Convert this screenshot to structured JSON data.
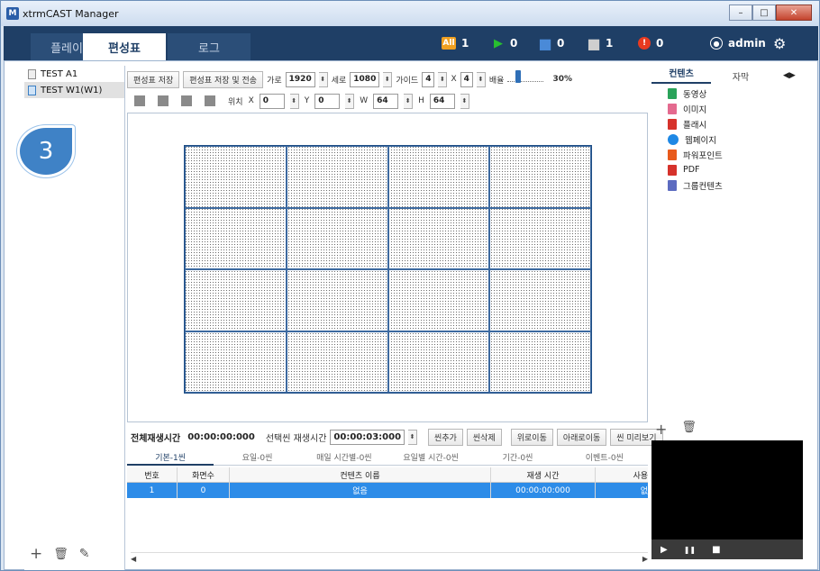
{
  "app": {
    "logo": "M",
    "title": "xtrmCAST Manager",
    "window_buttons": [
      "–",
      "□",
      "✕"
    ]
  },
  "nav": {
    "tabs": [
      "플레이어",
      "편성표",
      "로그"
    ],
    "stats": [
      {
        "icon": "All",
        "label": "1",
        "color": "#f0a020"
      },
      {
        "icon": "▶",
        "label": "0",
        "color": "#28c030"
      },
      {
        "icon": "■",
        "label": "0",
        "color": "#4a8ad8"
      },
      {
        "icon": "■",
        "label": "1",
        "color": "#cfcfcf"
      },
      {
        "icon": "!",
        "label": "0",
        "color": "#e83a20"
      }
    ],
    "user": "admin",
    "settings_icon": "⚙"
  },
  "left": {
    "items": [
      "TEST A1",
      "TEST W1(W1)"
    ],
    "footer": [
      "+",
      "🗑",
      "✎"
    ],
    "badge": "3"
  },
  "toolbar": {
    "save": "편성표 저장",
    "save_send": "편성표 저장 및 전송",
    "w_label": "가로",
    "w": "1920",
    "h_label": "세로",
    "h": "1080",
    "guide_label": "가이드",
    "guide_x": "4",
    "x_sep": "X",
    "guide_y": "4",
    "zoom_label": "배율",
    "zoom": "30%"
  },
  "pos": {
    "label": "위치",
    "x_label": "X",
    "x": "0",
    "y_label": "Y",
    "y": "0",
    "w_label": "W",
    "w": "64",
    "h_label": "H",
    "h": "64"
  },
  "play": {
    "total_label": "전체재생시간",
    "total": "00:00:00:000",
    "sel_label": "선택씬 재생시간",
    "sel": "00:00:03:000",
    "btns": [
      "씬추가",
      "씬삭제",
      "위로이동",
      "아래로이동",
      "씬 미리보기"
    ]
  },
  "scene_tabs": [
    "기본-1씬",
    "요일-0씬",
    "매일 시간별-0씬",
    "요일별 시간-0씬",
    "기간-0씬",
    "이벤트-0씬"
  ],
  "table": {
    "headers": [
      "번호",
      "화면수",
      "컨텐츠 이름",
      "재생 시간",
      "사용"
    ],
    "row": [
      "1",
      "0",
      "없음",
      "00:00:00:000",
      "없"
    ]
  },
  "right": {
    "tabs": [
      "컨텐츠",
      "자막"
    ],
    "arrows": "◀▶",
    "items": [
      {
        "label": "동영상",
        "color": "#2aa35a"
      },
      {
        "label": "이미지",
        "color": "#e46a8f"
      },
      {
        "label": "플래시",
        "color": "#d6322b"
      },
      {
        "label": "웹페이지",
        "color": "#1e88e5"
      },
      {
        "label": "파워포인트",
        "color": "#e85a1c"
      },
      {
        "label": "PDF",
        "color": "#d6322b"
      },
      {
        "label": "그룹컨텐츠",
        "color": "#5c6bc0"
      }
    ],
    "footer": [
      "+",
      "🗑"
    ],
    "controls": [
      "▶",
      "❚❚",
      "■"
    ]
  }
}
